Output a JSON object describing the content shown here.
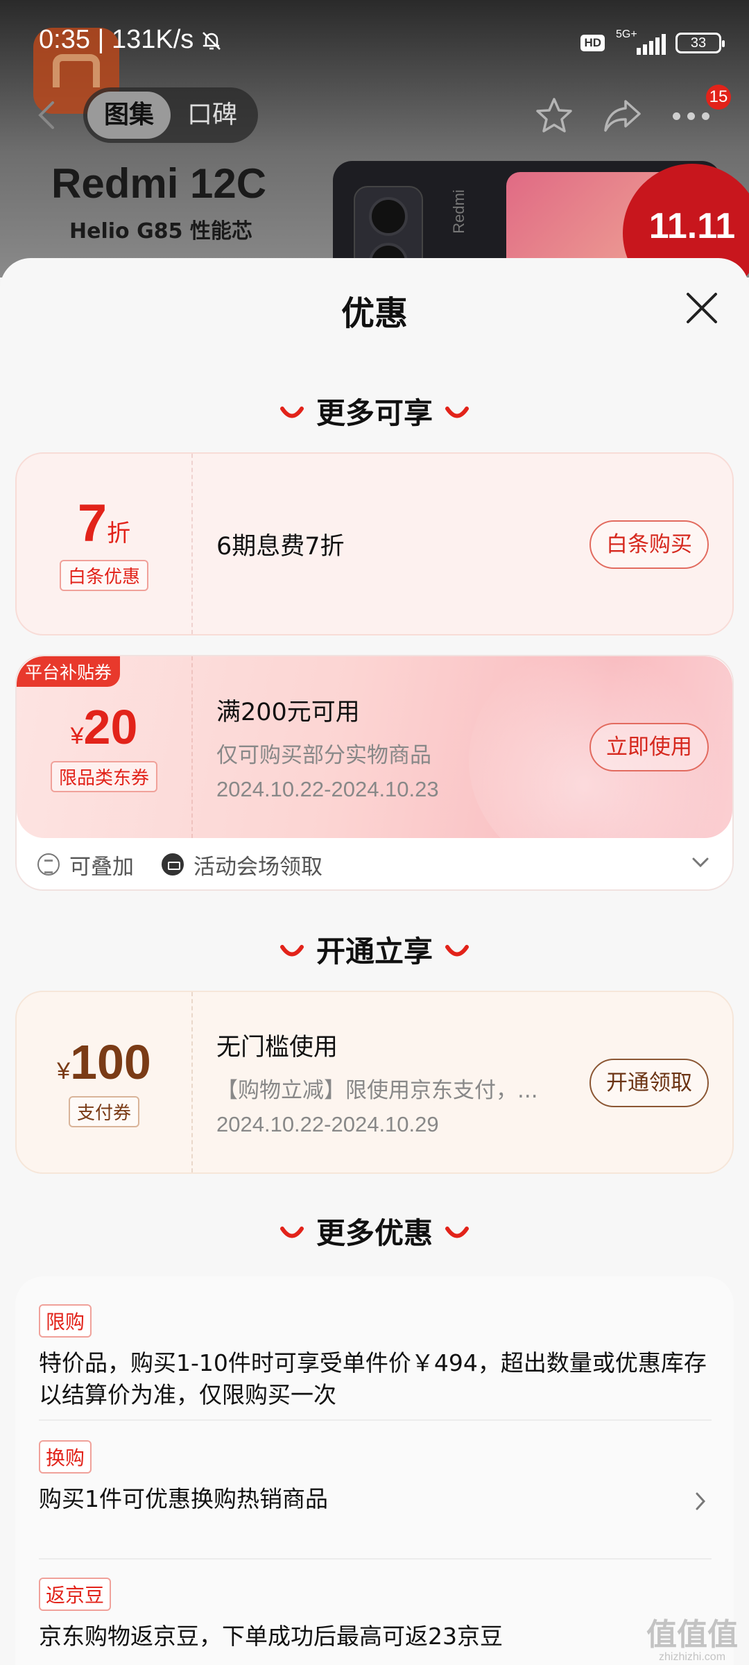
{
  "status_bar": {
    "time": "0:35 | 131K/s",
    "hd": "HD",
    "network": "5G+",
    "battery": "33"
  },
  "nav": {
    "tabs": [
      {
        "label": "图集",
        "active": true
      },
      {
        "label": "口碑",
        "active": false
      }
    ],
    "badge_count": "15"
  },
  "banner": {
    "title": "Redmi 12C",
    "subtitle": "Helio G85 性能芯",
    "phone_brand": "Redmi",
    "promo": "11.11"
  },
  "sheet": {
    "title": "优惠",
    "sections": {
      "more_enjoy": "更多可享",
      "open_enjoy": "开通立享",
      "more_offers": "更多优惠"
    },
    "baitiao": {
      "value": "7",
      "unit": "折",
      "tag": "白条优惠",
      "main": "6期息费7折",
      "button": "白条购买"
    },
    "coupon": {
      "corner": "平台补贴券",
      "currency": "¥",
      "value": "20",
      "tag": "限品类东券",
      "main": "满200元可用",
      "sub": "仅可购买部分实物商品",
      "date": "2024.10.22-2024.10.23",
      "button": "立即使用",
      "foot_stack": "可叠加",
      "foot_source": "活动会场领取"
    },
    "pay": {
      "currency": "¥",
      "value": "100",
      "tag": "支付券",
      "main": "无门槛使用",
      "sub": "【购物立减】限使用京东支付，...",
      "date": "2024.10.22-2024.10.29",
      "button": "开通领取"
    },
    "rules": [
      {
        "label": "限购",
        "text": "特价品，购买1-10件时可享受单件价￥494，超出数量或优惠库存以结算价为准，仅限购买一次"
      },
      {
        "label": "换购",
        "text": "购买1件可优惠换购热销商品"
      },
      {
        "label": "返京豆",
        "text": "京东购物返京豆，下单成功后最高可返23京豆"
      }
    ]
  },
  "watermark": {
    "main": "值值值",
    "sub": "zhizhizhi.com"
  },
  "colors": {
    "accent": "#e2231a",
    "pay_brown": "#7a3b16"
  },
  "icons": [
    "bell-mute-icon",
    "back-icon",
    "star-icon",
    "share-icon",
    "more-icon",
    "close-icon",
    "smile-icon",
    "stack-icon",
    "ticket-icon",
    "chevron-down-icon",
    "chevron-right-icon"
  ]
}
